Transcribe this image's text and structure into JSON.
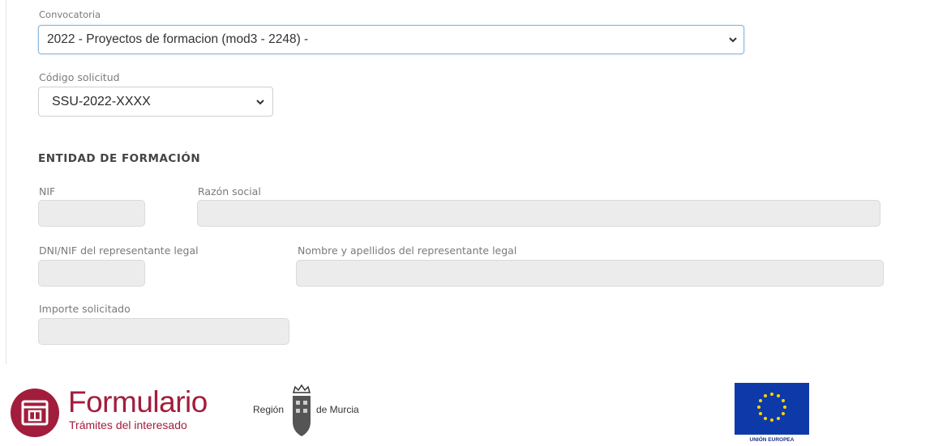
{
  "form": {
    "convocatoria": {
      "label": "Convocatoria",
      "value": "2022 - Proyectos de formacion (mod3 - 2248) -"
    },
    "codigo_solicitud": {
      "label": "Código solicitud",
      "value": "SSU-2022-XXXX"
    },
    "section_title": "ENTIDAD DE FORMACIÓN",
    "fields": {
      "nif": {
        "label": "NIF",
        "value": ""
      },
      "razon_social": {
        "label": "Razón social",
        "value": ""
      },
      "dni_representante": {
        "label": "DNI/NIF del representante legal",
        "value": ""
      },
      "nombre_representante": {
        "label": "Nombre y apellidos del representante legal",
        "value": ""
      },
      "importe": {
        "label": "Importe solicitado",
        "value": ""
      }
    }
  },
  "footer": {
    "brand_title": "Formulario",
    "brand_subtitle": "Trámites del interesado",
    "region_left": "Región",
    "region_right": "de Murcia",
    "eu_label": "UNIÓN EUROPEA",
    "brand_color": "#a21d3c",
    "eu_color": "#0d3aa8",
    "eu_star_color": "#ffd400"
  }
}
